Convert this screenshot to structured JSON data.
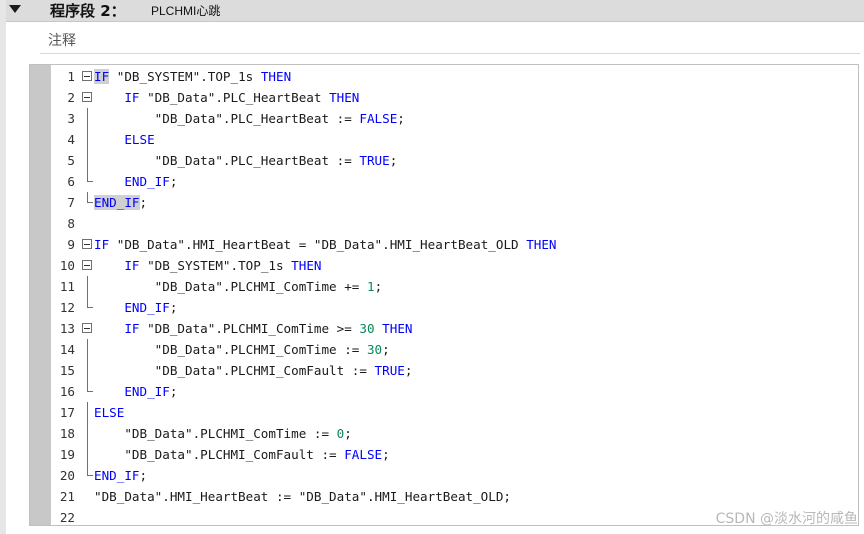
{
  "segment": {
    "title": "程序段 2：",
    "name": "PLCHMI心跳",
    "comment_label": "注释"
  },
  "code_lines": [
    {
      "num": "1",
      "tokens": [
        {
          "t": "IF",
          "c": "kw hl"
        },
        {
          "t": " \"DB_SYSTEM\".TOP_1s ",
          "c": ""
        },
        {
          "t": "THEN",
          "c": "kw"
        }
      ]
    },
    {
      "num": "2",
      "tokens": [
        {
          "t": "    IF",
          "c": "kw"
        },
        {
          "t": " \"DB_Data\".PLC_HeartBeat ",
          "c": ""
        },
        {
          "t": "THEN",
          "c": "kw"
        }
      ]
    },
    {
      "num": "3",
      "tokens": [
        {
          "t": "        \"DB_Data\".PLC_HeartBeat := ",
          "c": ""
        },
        {
          "t": "FALSE",
          "c": "kw"
        },
        {
          "t": ";",
          "c": ""
        }
      ]
    },
    {
      "num": "4",
      "tokens": [
        {
          "t": "    ELSE",
          "c": "kw"
        }
      ]
    },
    {
      "num": "5",
      "tokens": [
        {
          "t": "        \"DB_Data\".PLC_HeartBeat := ",
          "c": ""
        },
        {
          "t": "TRUE",
          "c": "kw"
        },
        {
          "t": ";",
          "c": ""
        }
      ]
    },
    {
      "num": "6",
      "tokens": [
        {
          "t": "    END_IF",
          "c": "kw"
        },
        {
          "t": ";",
          "c": ""
        }
      ]
    },
    {
      "num": "7",
      "tokens": [
        {
          "t": "END_IF",
          "c": "kw hl"
        },
        {
          "t": ";",
          "c": ""
        }
      ]
    },
    {
      "num": "8",
      "tokens": []
    },
    {
      "num": "9",
      "tokens": [
        {
          "t": "IF",
          "c": "kw"
        },
        {
          "t": " \"DB_Data\".HMI_HeartBeat = \"DB_Data\".HMI_HeartBeat_OLD ",
          "c": ""
        },
        {
          "t": "THEN",
          "c": "kw"
        }
      ]
    },
    {
      "num": "10",
      "tokens": [
        {
          "t": "    IF",
          "c": "kw"
        },
        {
          "t": " \"DB_SYSTEM\".TOP_1s ",
          "c": ""
        },
        {
          "t": "THEN",
          "c": "kw"
        }
      ]
    },
    {
      "num": "11",
      "tokens": [
        {
          "t": "        \"DB_Data\".PLCHMI_ComTime += ",
          "c": ""
        },
        {
          "t": "1",
          "c": "num"
        },
        {
          "t": ";",
          "c": ""
        }
      ]
    },
    {
      "num": "12",
      "tokens": [
        {
          "t": "    END_IF",
          "c": "kw"
        },
        {
          "t": ";",
          "c": ""
        }
      ]
    },
    {
      "num": "13",
      "tokens": [
        {
          "t": "    IF",
          "c": "kw"
        },
        {
          "t": " \"DB_Data\".PLCHMI_ComTime >= ",
          "c": ""
        },
        {
          "t": "30",
          "c": "num"
        },
        {
          "t": " ",
          "c": ""
        },
        {
          "t": "THEN",
          "c": "kw"
        }
      ]
    },
    {
      "num": "14",
      "tokens": [
        {
          "t": "        \"DB_Data\".PLCHMI_ComTime := ",
          "c": ""
        },
        {
          "t": "30",
          "c": "num"
        },
        {
          "t": ";",
          "c": ""
        }
      ]
    },
    {
      "num": "15",
      "tokens": [
        {
          "t": "        \"DB_Data\".PLCHMI_ComFault := ",
          "c": ""
        },
        {
          "t": "TRUE",
          "c": "kw"
        },
        {
          "t": ";",
          "c": ""
        }
      ]
    },
    {
      "num": "16",
      "tokens": [
        {
          "t": "    END_IF",
          "c": "kw"
        },
        {
          "t": ";",
          "c": ""
        }
      ]
    },
    {
      "num": "17",
      "tokens": [
        {
          "t": "ELSE",
          "c": "kw"
        }
      ]
    },
    {
      "num": "18",
      "tokens": [
        {
          "t": "    \"DB_Data\".PLCHMI_ComTime := ",
          "c": ""
        },
        {
          "t": "0",
          "c": "num"
        },
        {
          "t": ";",
          "c": ""
        }
      ]
    },
    {
      "num": "19",
      "tokens": [
        {
          "t": "    \"DB_Data\".PLCHMI_ComFault := ",
          "c": ""
        },
        {
          "t": "FALSE",
          "c": "kw"
        },
        {
          "t": ";",
          "c": ""
        }
      ]
    },
    {
      "num": "20",
      "tokens": [
        {
          "t": "END_IF",
          "c": "kw"
        },
        {
          "t": ";",
          "c": ""
        }
      ]
    },
    {
      "num": "21",
      "tokens": [
        {
          "t": "\"DB_Data\".HMI_HeartBeat := \"DB_Data\".HMI_HeartBeat_OLD;",
          "c": ""
        }
      ]
    },
    {
      "num": "22",
      "tokens": []
    }
  ],
  "watermark": "CSDN @淡水河的咸鱼",
  "colors": {
    "keyword": "#0000ff",
    "number": "#098658",
    "header_bg": "#dcdcdc",
    "gutter_bg": "#c8c8c8"
  }
}
